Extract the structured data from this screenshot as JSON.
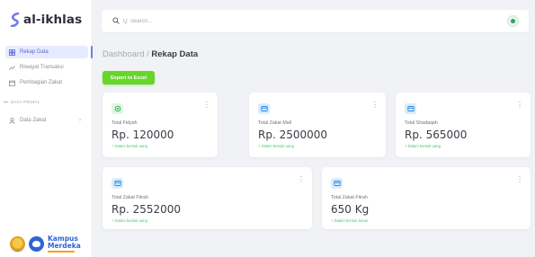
{
  "brand": {
    "name": "al-ikhlas",
    "color": "#2f2f3a",
    "accent": "#6f7de8"
  },
  "sidebar": {
    "items": [
      {
        "label": "Rekap Data",
        "icon": "grid-icon",
        "active": true
      },
      {
        "label": "Riwayat Transaksi",
        "icon": "trend-icon",
        "active": false
      },
      {
        "label": "Pembagian Zakat",
        "icon": "calendar-icon",
        "active": false
      }
    ],
    "section_label": "DATA PROFIL",
    "profile_item": {
      "label": "Data Zakat",
      "icon": "user-icon"
    },
    "logos": {
      "kampus_line1": "Kampus",
      "kampus_line2": "Merdeka"
    }
  },
  "search": {
    "placeholder": "Q  Search...",
    "icon": "search-icon"
  },
  "header": {
    "avatar_icon": "avatar-icon"
  },
  "breadcrumb": {
    "parent": "Dashboard",
    "separator": " / ",
    "current": "Rekap Data"
  },
  "actions": {
    "export_label": "Export to Excel",
    "export_color": "#66d62a"
  },
  "cards": [
    {
      "title": "Total Fidyah",
      "value": "Rp. 120000",
      "note": "+ Dalam bentuk uang",
      "icon": "gift-icon",
      "icon_color": "#2ea65a"
    },
    {
      "title": "Total Zakat Mall",
      "value": "Rp. 2500000",
      "note": "+ Dalam bentuk uang",
      "icon": "wallet-icon",
      "icon_color": "#2f8ae0"
    },
    {
      "title": "Total Shadaqah",
      "value": "Rp. 565000",
      "note": "+ Dalam bentuk uang",
      "icon": "wallet-icon",
      "icon_color": "#2f8ae0"
    },
    {
      "title": "Total Zakat Fitrah",
      "value": "Rp. 2552000",
      "note": "+ Dalam bentuk uang",
      "icon": "wallet-icon",
      "icon_color": "#2f8ae0"
    },
    {
      "title": "Total Zakat Fitrah",
      "value": "650 Kg",
      "note": "+ Dalam bentuk beras",
      "icon": "wallet-icon",
      "icon_color": "#2f8ae0"
    }
  ]
}
